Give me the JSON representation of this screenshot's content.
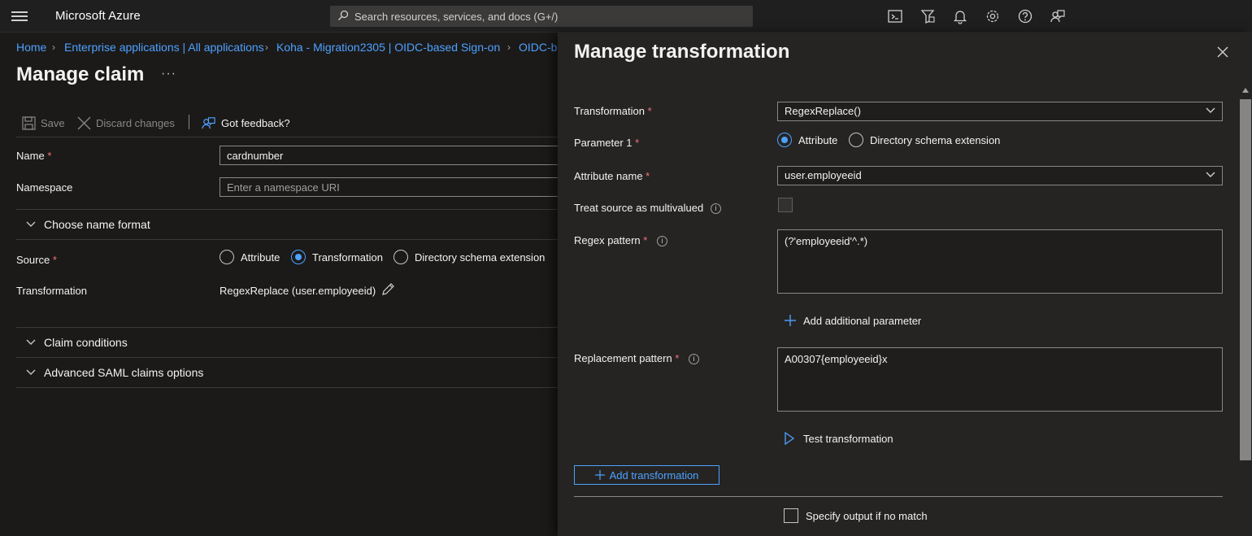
{
  "topbar": {
    "brand": "Microsoft Azure",
    "search_placeholder": "Search resources, services, and docs (G+/)",
    "icons": [
      "cloud-shell-icon",
      "directory-filter-icon",
      "notifications-icon",
      "settings-icon",
      "help-icon",
      "feedback-icon"
    ]
  },
  "breadcrumb": [
    "Home",
    "Enterprise applications | All applications",
    "Koha - Migration2305 | OIDC-based Sign-on",
    "OIDC-b"
  ],
  "page": {
    "title": "Manage claim",
    "more": "···"
  },
  "commands": {
    "save": "Save",
    "discard": "Discard changes",
    "feedback": "Got feedback?"
  },
  "form": {
    "name_label": "Name",
    "name_value": "cardnumber",
    "namespace_label": "Namespace",
    "namespace_placeholder": "Enter a namespace URI",
    "choose_name_format": "Choose name format",
    "source_label": "Source",
    "source_options": [
      "Attribute",
      "Transformation",
      "Directory schema extension"
    ],
    "source_selected": "Transformation",
    "transformation_label": "Transformation",
    "transformation_value": "RegexReplace (user.employeeid)",
    "claim_conditions": "Claim conditions",
    "advanced_saml": "Advanced SAML claims options"
  },
  "panel": {
    "title": "Manage transformation",
    "transformation_label": "Transformation",
    "transformation_value": "RegexReplace()",
    "parameter1_label": "Parameter 1",
    "parameter1_options": [
      "Attribute",
      "Directory schema extension"
    ],
    "parameter1_selected": "Attribute",
    "attribute_name_label": "Attribute name",
    "attribute_name_value": "user.employeeid",
    "treat_multivalued_label": "Treat source as multivalued",
    "regex_label": "Regex pattern",
    "regex_value": "(?'employeeid'^.*)",
    "add_param": "Add additional parameter",
    "replacement_label": "Replacement pattern",
    "replacement_value": "A00307{employeeid}x",
    "test_transformation": "Test transformation",
    "add_transformation": "Add transformation",
    "specify_output": "Specify output if no match"
  },
  "colors": {
    "accent": "#4ea1ff",
    "required": "#f1707b",
    "background": "#1b1a19",
    "panel": "#252423"
  }
}
